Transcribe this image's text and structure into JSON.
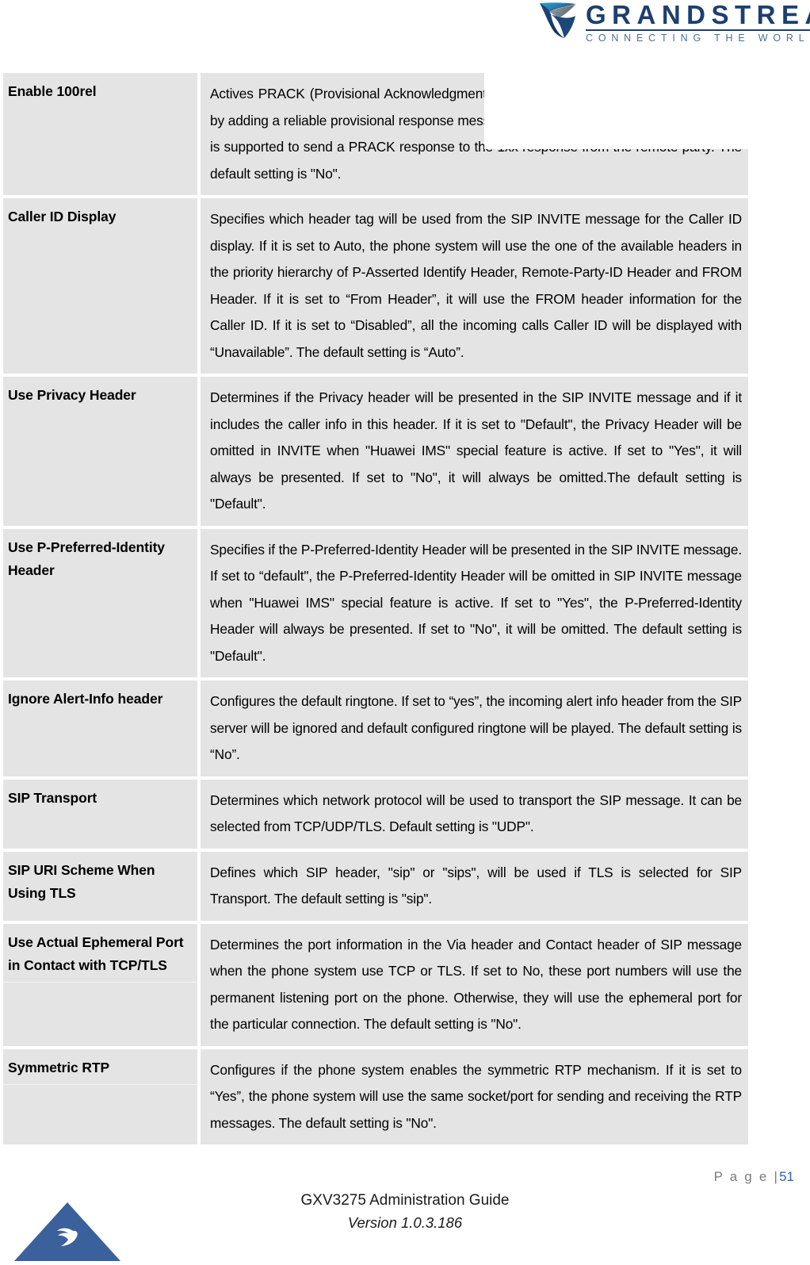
{
  "document": {
    "brand": {
      "wordmark": "GRANDSTREAM",
      "tagline": "CONNECTING THE WORLD"
    },
    "footer": {
      "page_label": "P a g e  |",
      "page_number": "51",
      "guide_title": "GXV3275 Administration Guide",
      "version": "Version 1.0.3.186"
    },
    "colors": {
      "table_cell_bg": "#e4e4e4",
      "brand_blue": "#1c3f6e",
      "brand_blue_light": "#4a6f9c",
      "triangle_blue": "#3a619c",
      "page_number_blue": "#2f5fb5",
      "page_label_gray": "#7b7b7b"
    }
  },
  "table": {
    "rows": [
      {
        "label": "Enable 100rel",
        "description": "Actives PRACK (Provisional Acknowledgment) method to improve the network reliability by adding a reliable provisional response message for the provisional Responses (1xx). It is supported to send a PRACK response to the 1xx response from the remote party. The default setting is \"No\".",
        "label_sub_rows": 0,
        "occluded_by_logo": true
      },
      {
        "label": "Caller ID Display",
        "description": "Specifies which header tag will be used from the SIP INVITE message for the Caller ID display. If it is set to Auto, the phone system will use the one of the available headers in the priority hierarchy of P-Asserted Identify Header, Remote-Party-ID Header and FROM Header. If it is set to “From Header”, it will use the FROM header information for the Caller ID. If it is set to “Disabled”, all the incoming calls Caller ID will be displayed with “Unavailable”. The default setting is “Auto”.",
        "label_sub_rows": 0,
        "occluded_by_logo": false
      },
      {
        "label": "Use Privacy Header",
        "description": "Determines if the Privacy header will be presented in the SIP INVITE message and if it includes the caller info in this header. If it is set to \"Default\", the Privacy Header will be omitted in INVITE when \"Huawei IMS\" special feature is active. If set to \"Yes\", it will always be presented. If set to \"No\", it will always be omitted.The default setting is \"Default\".",
        "label_sub_rows": 0,
        "occluded_by_logo": false
      },
      {
        "label": "Use P-Preferred-Identity Header",
        "description": "Specifies if the P-Preferred-Identity Header will be presented in the SIP INVITE message. If set to “default\", the P-Preferred-Identity Header will be omitted in SIP INVITE message when \"Huawei IMS\" special feature is active. If set to \"Yes\", the P-Preferred-Identity Header will always be presented. If set to \"No\", it will be omitted. The default setting is \"Default\".",
        "label_sub_rows": 0,
        "occluded_by_logo": false
      },
      {
        "label": "Ignore Alert-Info header",
        "description": "Configures the default ringtone. If set to “yes”, the incoming alert info header from the SIP server will be ignored and default configured ringtone will be played. The default setting is “No”.",
        "label_sub_rows": 0,
        "occluded_by_logo": false
      },
      {
        "label": "SIP Transport",
        "description": "Determines which network protocol will be used to transport the SIP message. It can be selected from TCP/UDP/TLS. Default setting is \"UDP\".",
        "label_sub_rows": 0,
        "occluded_by_logo": false
      },
      {
        "label": "SIP URI Scheme When Using TLS",
        "description": "Defines which SIP header, \"sip\" or \"sips\", will be used if TLS is selected for SIP Transport. The default setting is \"sip\".",
        "label_sub_rows": 0,
        "occluded_by_logo": false
      },
      {
        "label": "Use Actual Ephemeral Port in Contact with TCP/TLS",
        "description": "Determines the port information in the Via header and Contact header of SIP message when the phone system use TCP or TLS. If set to No, these port numbers will use the permanent listening port on the phone. Otherwise, they will use the ephemeral port for the particular connection. The default setting is \"No\".",
        "label_sub_rows": 1,
        "occluded_by_logo": false
      },
      {
        "label": "Symmetric RTP",
        "description": "Configures if the phone system enables the symmetric RTP mechanism. If it is set to “Yes”, the phone system will use the same socket/port for sending and receiving the RTP messages. The default setting is \"No\".",
        "label_sub_rows": 1,
        "occluded_by_logo": false
      }
    ]
  }
}
